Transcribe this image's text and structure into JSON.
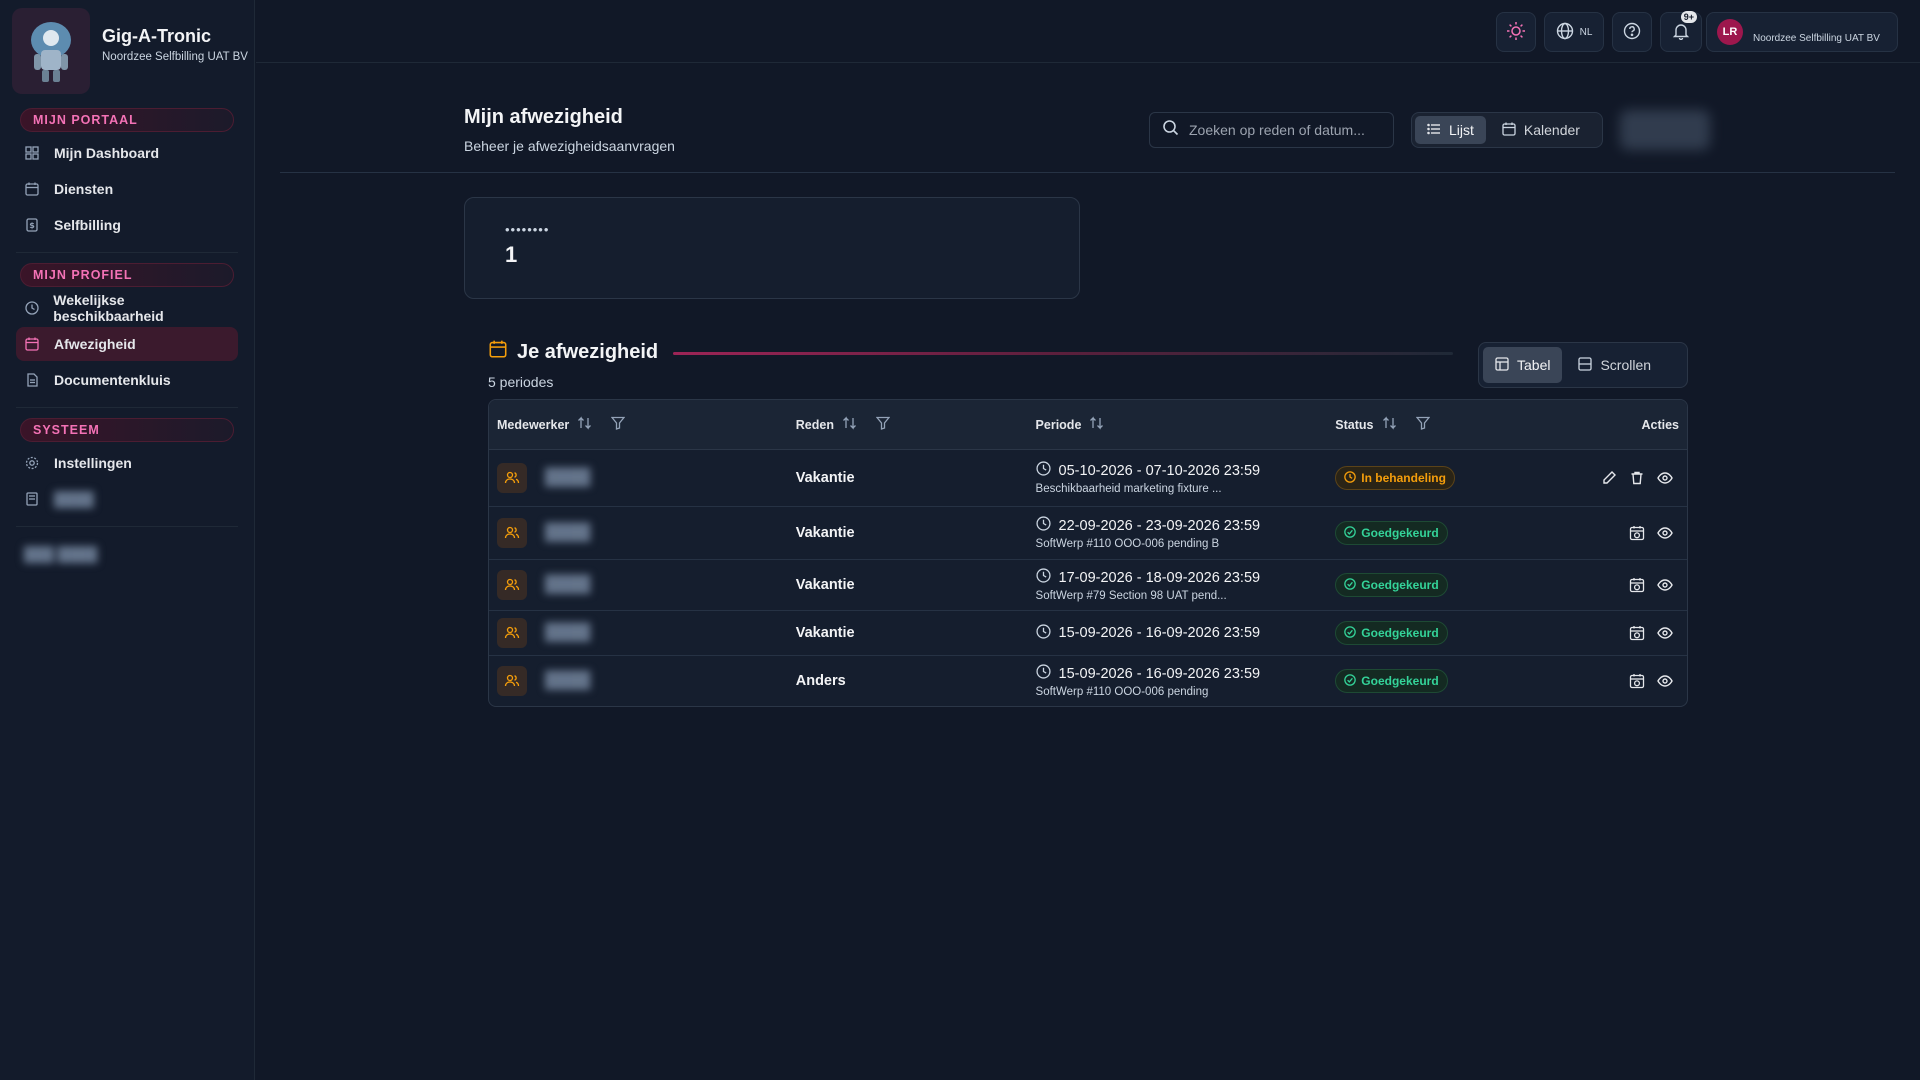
{
  "app": {
    "name": "Gig-A-Tronic",
    "tenant": "Noordzee Selfbilling UAT BV"
  },
  "sidebar": {
    "sections": [
      {
        "label": "MIJN PORTAAL",
        "items": [
          {
            "label": "Mijn Dashboard",
            "icon": "grid-icon"
          },
          {
            "label": "Diensten",
            "icon": "calendar-icon"
          },
          {
            "label": "Selfbilling",
            "icon": "invoice-icon"
          }
        ]
      },
      {
        "label": "MIJN PROFIEL",
        "items": [
          {
            "label": "Wekelijkse beschikbaarheid",
            "icon": "clock-icon"
          },
          {
            "label": "Afwezigheid",
            "icon": "calendar-icon",
            "active": true
          },
          {
            "label": "Documentenkluis",
            "icon": "document-icon"
          }
        ]
      },
      {
        "label": "SYSTEEM",
        "items": [
          {
            "label": "Instellingen",
            "icon": "gear-icon"
          }
        ]
      }
    ]
  },
  "topbar": {
    "language": "NL",
    "notifications_badge": "9+",
    "user_initials": "LR",
    "user_company": "Noordzee Selfbilling UAT BV"
  },
  "page": {
    "title": "Mijn afwezigheid",
    "subtitle": "Beheer je afwezigheidsaanvragen",
    "search_placeholder": "Zoeken op reden of datum...",
    "view_list": "Lijst",
    "view_calendar": "Kalender"
  },
  "stat": {
    "label": "••••••••",
    "value": "1"
  },
  "section": {
    "title": "Je afwezigheid",
    "count": "5 periodes",
    "toggle_table": "Tabel",
    "toggle_scroll": "Scrollen"
  },
  "table": {
    "columns": {
      "employee": "Medewerker",
      "reason": "Reden",
      "period": "Periode",
      "status": "Status",
      "actions": "Acties"
    },
    "rows": [
      {
        "reason": "Vakantie",
        "period": "05-10-2026 - 07-10-2026 23:59",
        "note": "Beschikbaarheid marketing fixture ...",
        "status": "In behandeling",
        "status_type": "pending"
      },
      {
        "reason": "Vakantie",
        "period": "22-09-2026 - 23-09-2026 23:59",
        "note": "SoftWerp #110 OOO-006 pending B",
        "status": "Goedgekeurd",
        "status_type": "approved"
      },
      {
        "reason": "Vakantie",
        "period": "17-09-2026 - 18-09-2026 23:59",
        "note": "SoftWerp #79 Section 98 UAT pend...",
        "status": "Goedgekeurd",
        "status_type": "approved"
      },
      {
        "reason": "Vakantie",
        "period": "15-09-2026 - 16-09-2026 23:59",
        "note": "",
        "status": "Goedgekeurd",
        "status_type": "approved"
      },
      {
        "reason": "Anders",
        "period": "15-09-2026 - 16-09-2026 23:59",
        "note": "SoftWerp #110 OOO-006 pending",
        "status": "Goedgekeurd",
        "status_type": "approved"
      }
    ]
  },
  "colors": {
    "accent": "#f472b6",
    "pending": "#f59e0b",
    "approved": "#34d399",
    "background": "#111827"
  }
}
